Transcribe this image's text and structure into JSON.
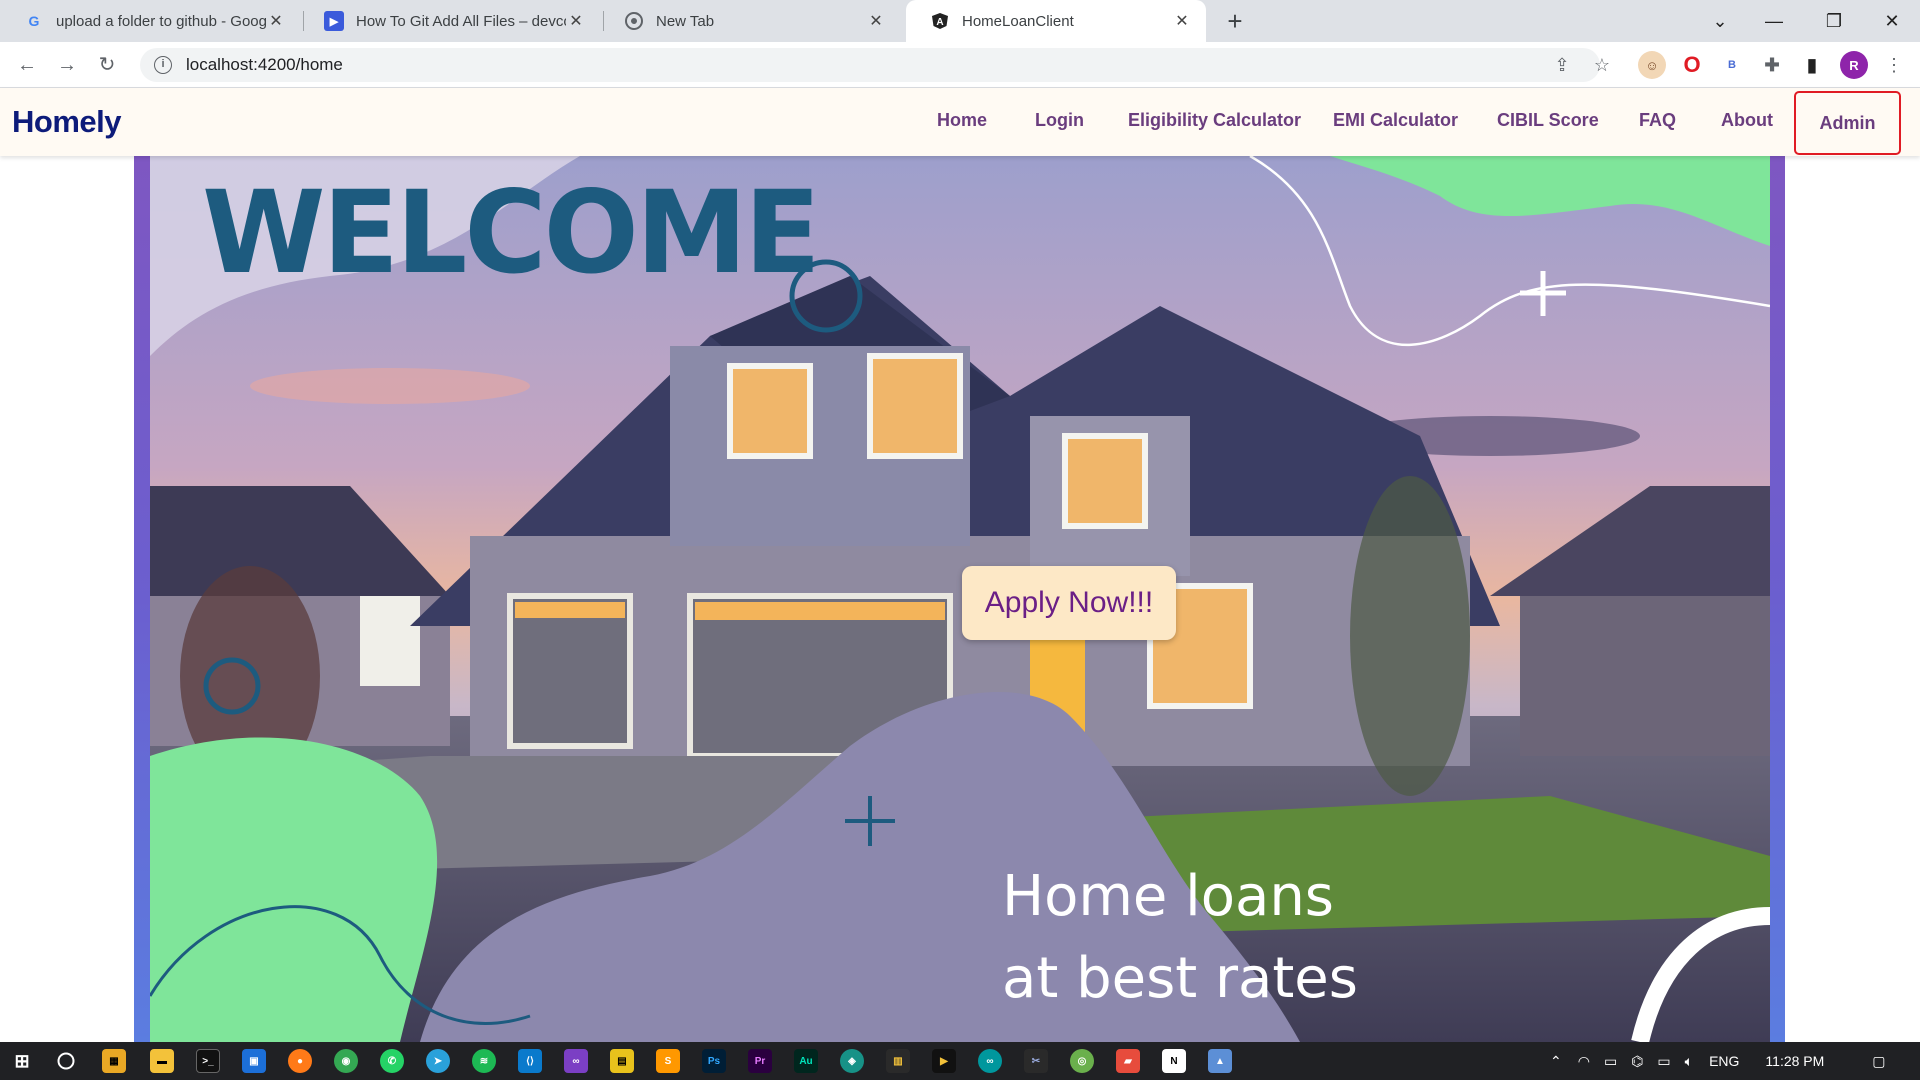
{
  "browser": {
    "tabs": [
      {
        "title": "upload a folder to github - Goog",
        "favicon": "google-icon",
        "active": false
      },
      {
        "title": "How To Git Add All Files – devcor",
        "favicon": "devconnected-icon",
        "active": false
      },
      {
        "title": "New Tab",
        "favicon": "chrome-icon",
        "active": false
      },
      {
        "title": "HomeLoanClient",
        "favicon": "angular-icon",
        "active": true
      }
    ],
    "url": "localhost:4200/home",
    "profile_initial": "R"
  },
  "navbar": {
    "brand": "Homely",
    "links": [
      "Home",
      "Login",
      "Eligibility Calculator",
      "EMI Calculator",
      "CIBIL Score",
      "FAQ",
      "About"
    ],
    "admin": "Admin"
  },
  "hero": {
    "welcome": "WELCOME",
    "apply_button": "Apply Now!!!",
    "tagline_line1": "Home loans",
    "tagline_line2": "at best rates"
  },
  "taskbar": {
    "language": "ENG",
    "time": "11:28 PM"
  }
}
